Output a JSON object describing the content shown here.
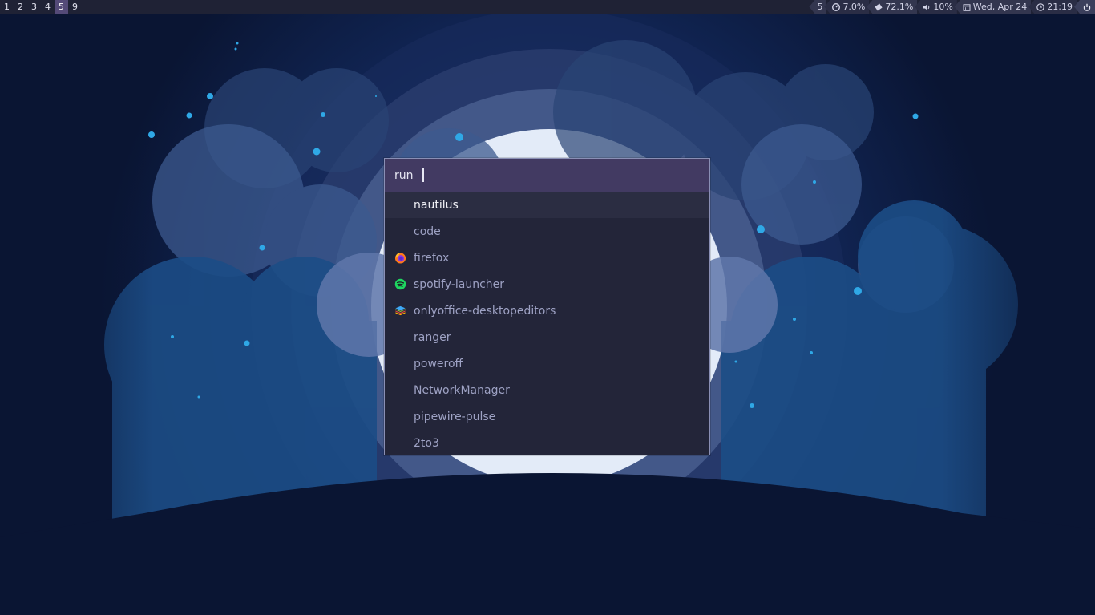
{
  "topbar": {
    "workspaces": [
      "1",
      "2",
      "3",
      "4",
      "5",
      "9"
    ],
    "active_workspace": "5",
    "tray": {
      "window_count": "5",
      "cpu": "7.0%",
      "memory": "72.1%",
      "volume": "10%",
      "date": "Wed, Apr 24",
      "time": "21:19"
    },
    "icons": {
      "cpu": "speedometer-icon",
      "memory": "memory-chip-icon",
      "volume": "speaker-icon",
      "date": "calendar-icon",
      "time": "clock-icon",
      "power": "power-icon"
    }
  },
  "launcher": {
    "prompt": "run",
    "query": "",
    "results": [
      {
        "label": "nautilus",
        "icon": null
      },
      {
        "label": "code",
        "icon": null
      },
      {
        "label": "firefox",
        "icon": "firefox-icon"
      },
      {
        "label": "spotify-launcher",
        "icon": "spotify-icon"
      },
      {
        "label": "onlyoffice-desktopeditors",
        "icon": "onlyoffice-icon"
      },
      {
        "label": "ranger",
        "icon": null
      },
      {
        "label": "poweroff",
        "icon": null
      },
      {
        "label": "NetworkManager",
        "icon": null
      },
      {
        "label": "pipewire-pulse",
        "icon": null
      },
      {
        "label": "2to3",
        "icon": null
      }
    ],
    "selected_index": 0
  },
  "colors": {
    "bar_bg": "#1f2235",
    "active_workspace": "#544a78",
    "launcher_bg": "#232539",
    "prompt_bg": "#423a62",
    "selected_row": "#2b2d42"
  }
}
